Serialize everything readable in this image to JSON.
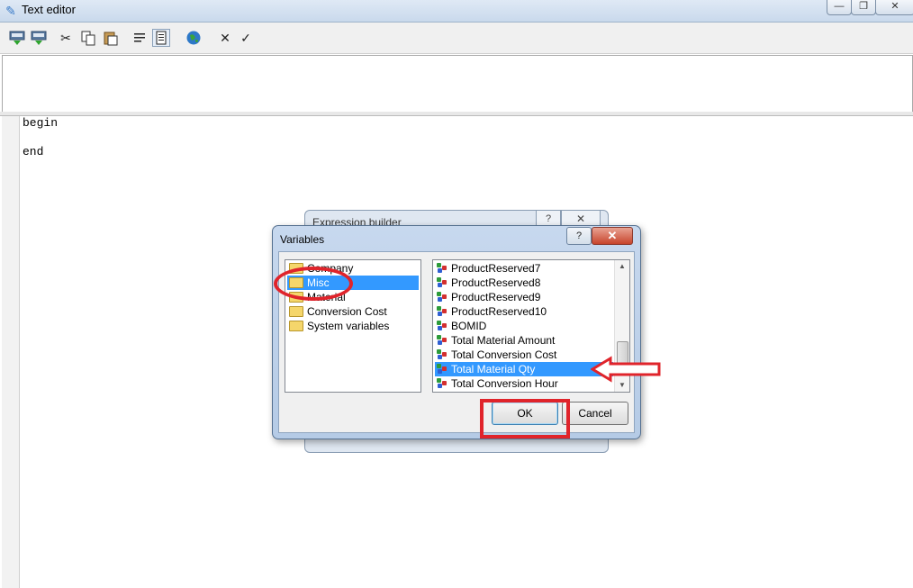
{
  "window": {
    "title": "Text editor",
    "controls": [
      "—",
      "❐",
      "✕"
    ]
  },
  "toolbar": {
    "icons": [
      "insert-icon",
      "insert-alt-icon",
      "cut-icon",
      "copy-icon",
      "paste-icon",
      "align-icon",
      "page-icon",
      "globe-icon",
      "cancel-x-icon",
      "check-icon"
    ]
  },
  "editor": {
    "lines": [
      "begin",
      "end"
    ]
  },
  "background_dialog": {
    "title": "Expression builder",
    "help": "?",
    "close": "✕"
  },
  "variables_dialog": {
    "title": "Variables",
    "help": "?",
    "close": "✕",
    "tree": [
      {
        "label": "Company",
        "selected": false
      },
      {
        "label": "Misc",
        "selected": true
      },
      {
        "label": "Material",
        "selected": false
      },
      {
        "label": "Conversion Cost",
        "selected": false
      },
      {
        "label": "System variables",
        "selected": false
      }
    ],
    "list": [
      {
        "label": "ProductReserved7",
        "selected": false
      },
      {
        "label": "ProductReserved8",
        "selected": false
      },
      {
        "label": "ProductReserved9",
        "selected": false
      },
      {
        "label": "ProductReserved10",
        "selected": false
      },
      {
        "label": "BOMID",
        "selected": false
      },
      {
        "label": "Total Material Amount",
        "selected": false
      },
      {
        "label": "Total Conversion Cost",
        "selected": false
      },
      {
        "label": "Total Material Qty",
        "selected": true
      },
      {
        "label": "Total Conversion Hour",
        "selected": false
      }
    ],
    "ok_label": "OK",
    "cancel_label": "Cancel"
  },
  "annotation_color": "#e0242b"
}
